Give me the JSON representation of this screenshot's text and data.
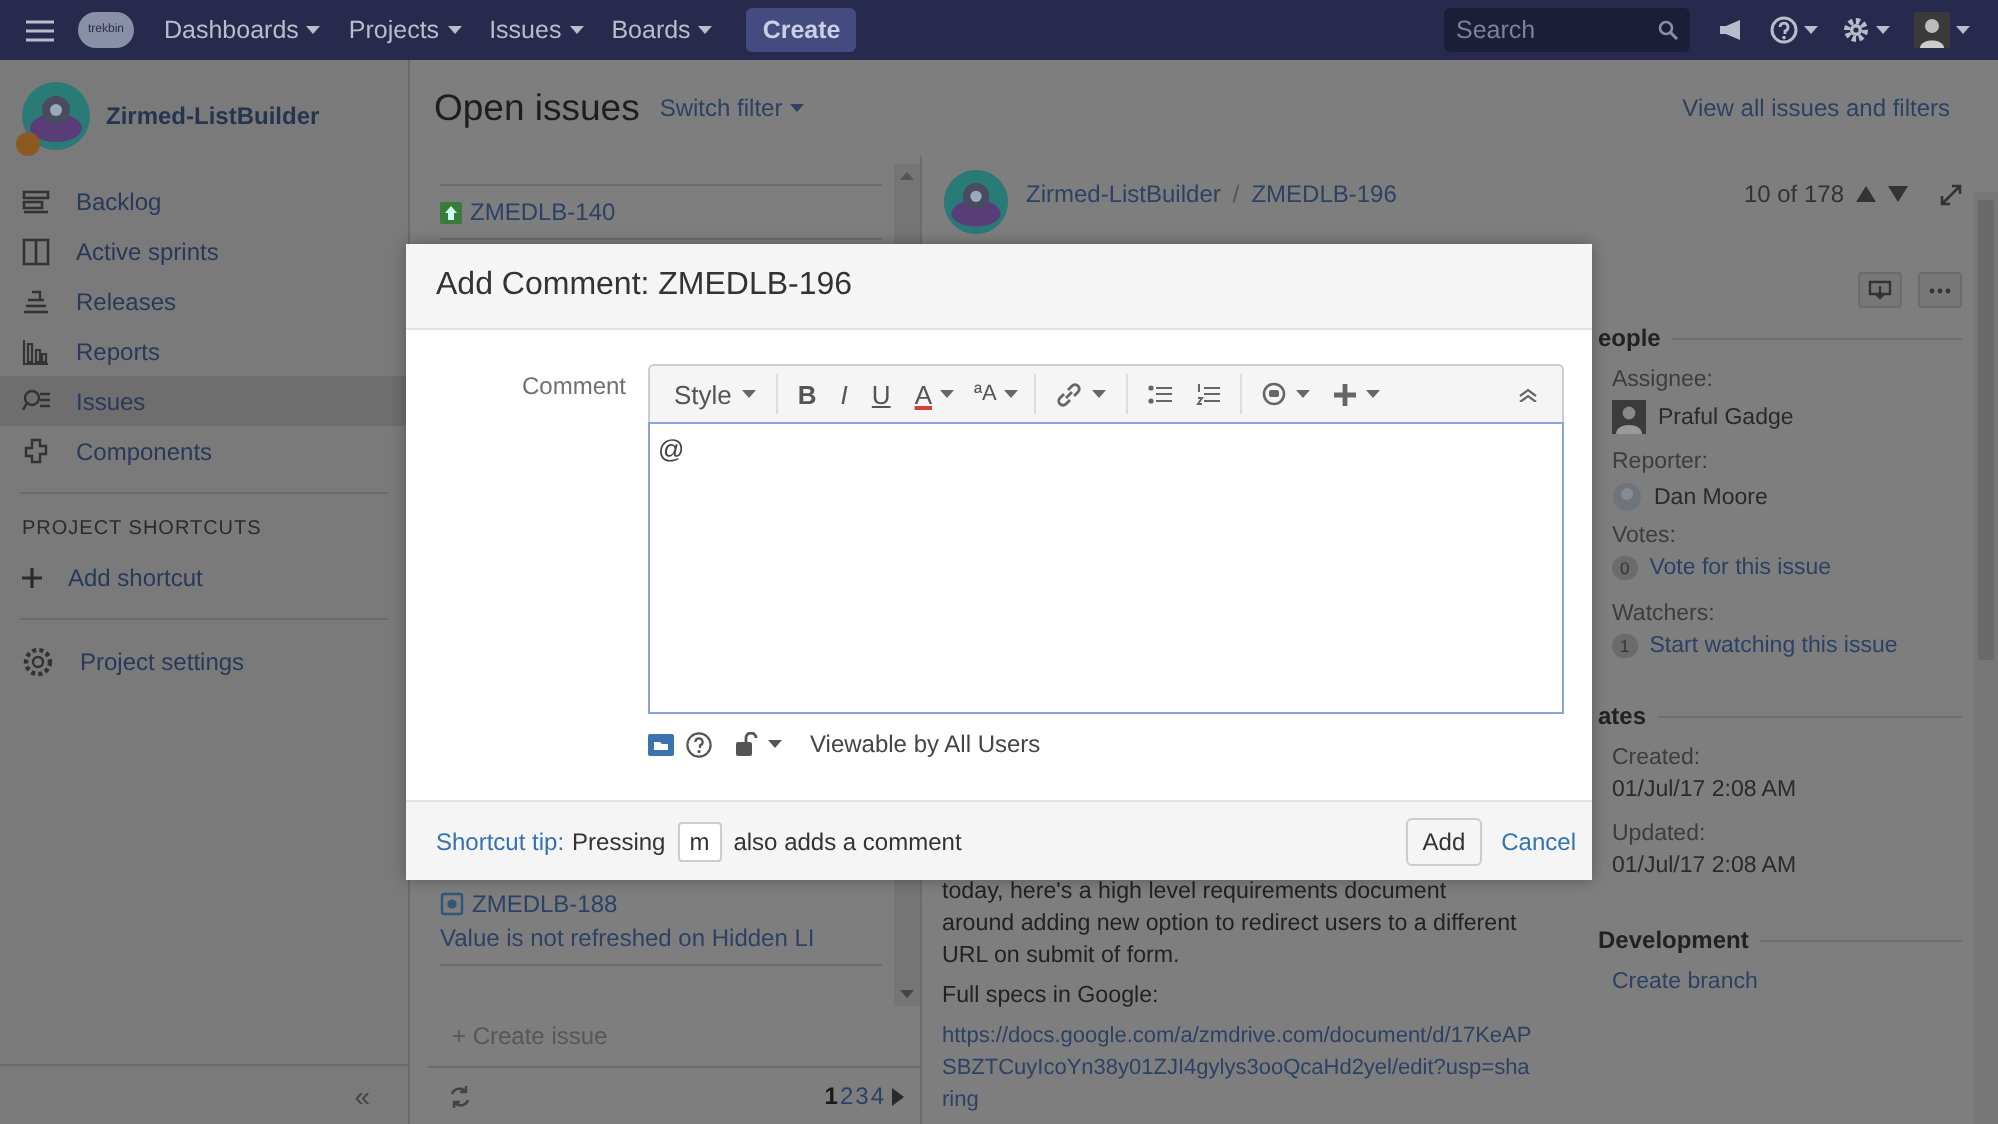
{
  "topbar": {
    "logo": "trekbin",
    "nav": [
      {
        "label": "Dashboards"
      },
      {
        "label": "Projects"
      },
      {
        "label": "Issues"
      },
      {
        "label": "Boards"
      }
    ],
    "create": "Create",
    "search": {
      "placeholder": "Search"
    }
  },
  "sidebar": {
    "project": "Zirmed-ListBuilder",
    "items": [
      {
        "kind": "backlog",
        "label": "Backlog",
        "selected": false
      },
      {
        "kind": "sprints",
        "label": "Active sprints",
        "selected": false
      },
      {
        "kind": "releases",
        "label": "Releases",
        "selected": false
      },
      {
        "kind": "reports",
        "label": "Reports",
        "selected": false
      },
      {
        "kind": "issues",
        "label": "Issues",
        "selected": true
      },
      {
        "kind": "components",
        "label": "Components",
        "selected": false
      }
    ],
    "shortcuts_heading": "PROJECT SHORTCUTS",
    "add_shortcut": "Add shortcut",
    "settings": "Project settings",
    "collapse": "«"
  },
  "filter": {
    "title": "Open issues",
    "switch": "Switch filter",
    "view_all": "View all issues and filters"
  },
  "issue_list": {
    "items": [
      {
        "kind": "story",
        "key": "ZMEDLB-140"
      },
      {
        "kind": "bug",
        "key": "ZMEDLB-188",
        "summary": "Value is not refreshed on Hidden LI"
      }
    ],
    "create": "+ Create issue",
    "pages": [
      {
        "label": "1",
        "selected": true
      },
      {
        "label": "2",
        "selected": false
      },
      {
        "label": "3",
        "selected": false
      },
      {
        "label": "4",
        "selected": false
      }
    ]
  },
  "detail": {
    "project": "Zirmed-ListBuilder",
    "separator": "/",
    "issue": "ZMEDLB-196",
    "position": "10 of 178",
    "paragraphs": [
      {
        "kind": "text",
        "text": "today, here's a high level requirements document around adding new option to redirect users to a different URL on submit of form."
      },
      {
        "kind": "text",
        "text": "Full specs in Google:"
      },
      {
        "kind": "link",
        "text": "https://docs.google.com/a/zmdrive.com/document/d/17KeAPSBZTCuyIcoYn38y01ZJI4gylys3ooQcaHd2yel/edit?usp=sharing"
      }
    ],
    "people": {
      "heading": "eople",
      "assignee_label": "Assignee:",
      "assignee": "Praful Gadge",
      "reporter_label": "Reporter:",
      "reporter": "Dan Moore",
      "votes_label": "Votes:",
      "votes": "0",
      "vote_action": "Vote for this issue",
      "watchers_label": "Watchers:",
      "watchers": "1",
      "watch_action": "Start watching this issue"
    },
    "dates": {
      "heading": "ates",
      "created_label": "Created:",
      "created": "01/Jul/17 2:08 AM",
      "updated_label": "Updated:",
      "updated": "01/Jul/17 2:08 AM"
    },
    "development": {
      "heading": "Development",
      "action": "Create branch"
    }
  },
  "modal": {
    "title": "Add Comment: ZMEDLB-196",
    "field_label": "Comment",
    "style_menu": "Style",
    "format": [
      {
        "kind": "bold",
        "label": "B"
      },
      {
        "kind": "italic",
        "label": "I"
      },
      {
        "kind": "underline",
        "label": "U"
      },
      {
        "kind": "color",
        "label": "A"
      },
      {
        "kind": "size",
        "label": "ªA"
      }
    ],
    "value": "@",
    "visibility": "Viewable by All Users",
    "tip_link": "Shortcut tip:",
    "tip_before": "Pressing",
    "tip_key": "m",
    "tip_after": "also adds a comment",
    "add": "Add",
    "cancel": "Cancel"
  }
}
